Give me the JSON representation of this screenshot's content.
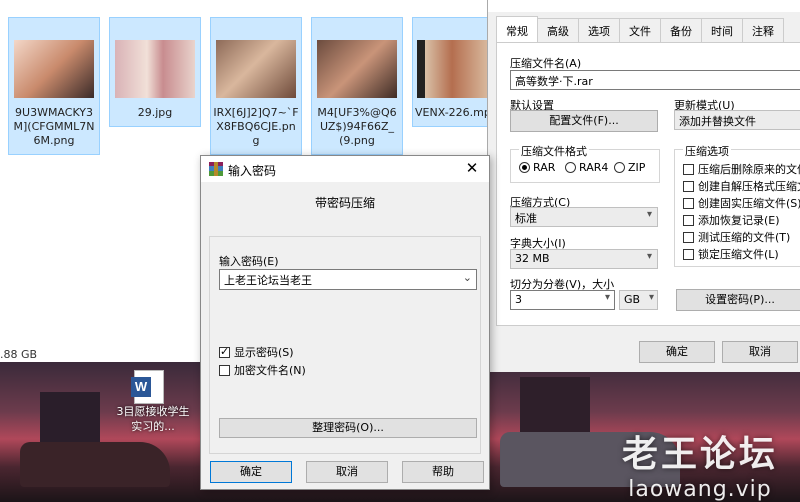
{
  "explorer": {
    "files": [
      {
        "name": "9U3WMACKY3M](CFGMML7N6M.png"
      },
      {
        "name": "29.jpg"
      },
      {
        "name": "IRX[6J]2]Q7~`FX8FBQ6CJE.png"
      },
      {
        "name": "M4[UF3%@Q6UZ$)94F66Z_(9.png"
      },
      {
        "name": "VENX-226.mp"
      }
    ],
    "storage": ".88 GB"
  },
  "desktop": {
    "word_file_label": "3目愿接收学生实习的...",
    "word_icon_letter": "W",
    "watermark_big": "老王论坛",
    "watermark_small": "laowang.vip"
  },
  "archive_dialog": {
    "tabs": [
      "常规",
      "高级",
      "选项",
      "文件",
      "备份",
      "时间",
      "注释"
    ],
    "archive_name_label": "压缩文件名(A)",
    "archive_name_value": "高等数学·下.rar",
    "default_settings_label": "默认设置",
    "profiles_button": "配置文件(F)...",
    "update_mode_label": "更新模式(U)",
    "update_mode_value": "添加并替换文件",
    "format_group_label": "压缩文件格式",
    "format_options": [
      "RAR",
      "RAR4",
      "ZIP"
    ],
    "format_selected": "RAR",
    "method_label": "压缩方式(C)",
    "method_value": "标准",
    "dict_label": "字典大小(I)",
    "dict_value": "32 MB",
    "split_label": "切分为分卷(V)，大小",
    "split_value": "3",
    "split_unit": "GB",
    "options_group_label": "压缩选项",
    "options": [
      {
        "label": "压缩后删除原来的文件",
        "checked": false
      },
      {
        "label": "创建自解压格式压缩文",
        "checked": false
      },
      {
        "label": "创建固实压缩文件(S)",
        "checked": false
      },
      {
        "label": "添加恢复记录(E)",
        "checked": false
      },
      {
        "label": "测试压缩的文件(T)",
        "checked": false
      },
      {
        "label": "锁定压缩文件(L)",
        "checked": false
      }
    ],
    "set_password_button": "设置密码(P)...",
    "ok_button": "确定",
    "cancel_button": "取消"
  },
  "password_dialog": {
    "title": "输入密码",
    "subtitle": "带密码压缩",
    "password_label": "输入密码(E)",
    "password_value": "上老王论坛当老王",
    "show_password_label": "显示密码(S)",
    "show_password_checked": true,
    "encrypt_names_label": "加密文件名(N)",
    "encrypt_names_checked": false,
    "organize_button": "整理密码(O)...",
    "ok_button": "确定",
    "cancel_button": "取消",
    "help_button": "帮助",
    "close_glyph": "✕"
  }
}
